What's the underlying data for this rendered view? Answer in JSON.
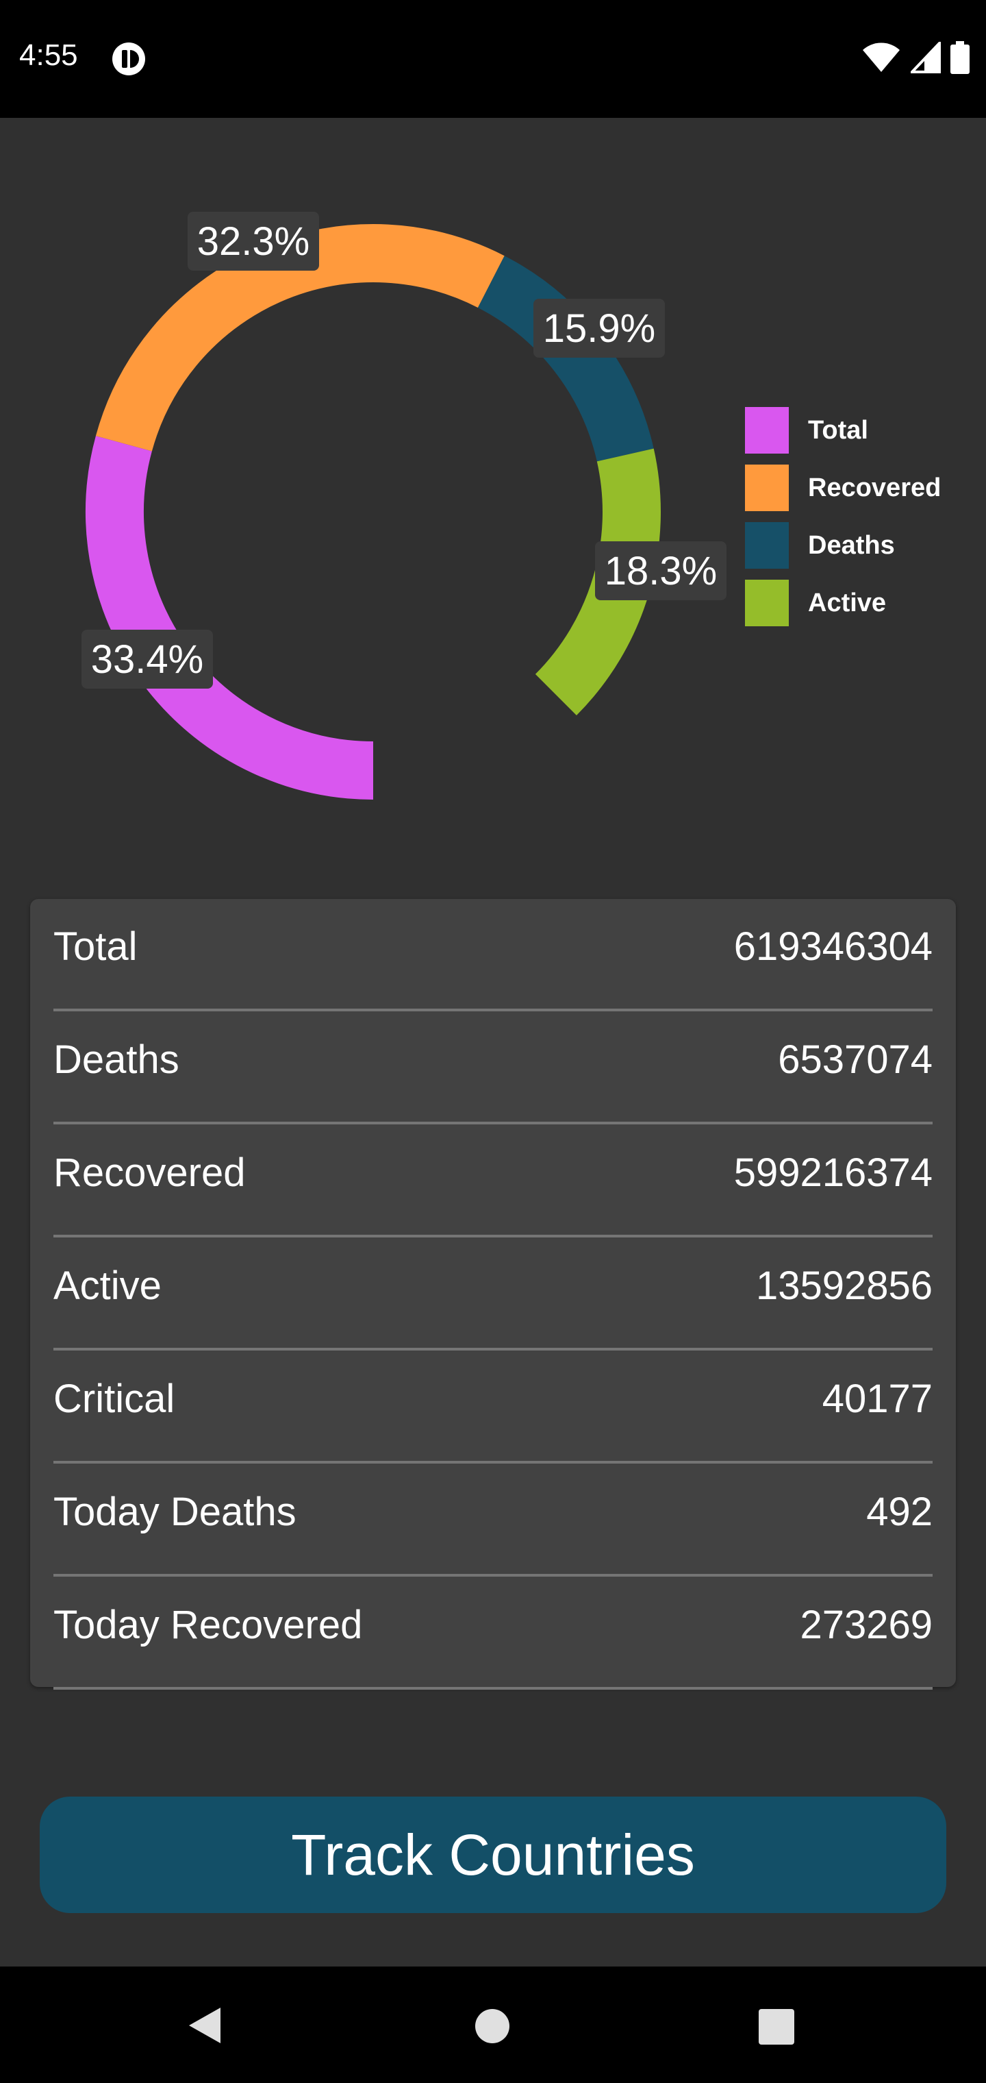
{
  "status_bar": {
    "time": "4:55"
  },
  "chart_data": {
    "type": "pie",
    "categories": [
      "Total",
      "Recovered",
      "Deaths",
      "Active"
    ],
    "values": [
      33.4,
      32.3,
      15.9,
      18.3
    ],
    "labels": [
      "33.4%",
      "32.3%",
      "15.9%",
      "18.3%"
    ],
    "colors": [
      "#d957ef",
      "#ff9a3d",
      "#165068",
      "#95bd2a"
    ],
    "legend_position": "right"
  },
  "stats": [
    {
      "label": "Total",
      "value": "619346304"
    },
    {
      "label": "Deaths",
      "value": "6537074"
    },
    {
      "label": "Recovered",
      "value": "599216374"
    },
    {
      "label": "Active",
      "value": "13592856"
    },
    {
      "label": "Critical",
      "value": "40177"
    },
    {
      "label": "Today Deaths",
      "value": "492"
    },
    {
      "label": "Today Recovered",
      "value": "273269"
    }
  ],
  "track_button": {
    "label": "Track Countries"
  }
}
